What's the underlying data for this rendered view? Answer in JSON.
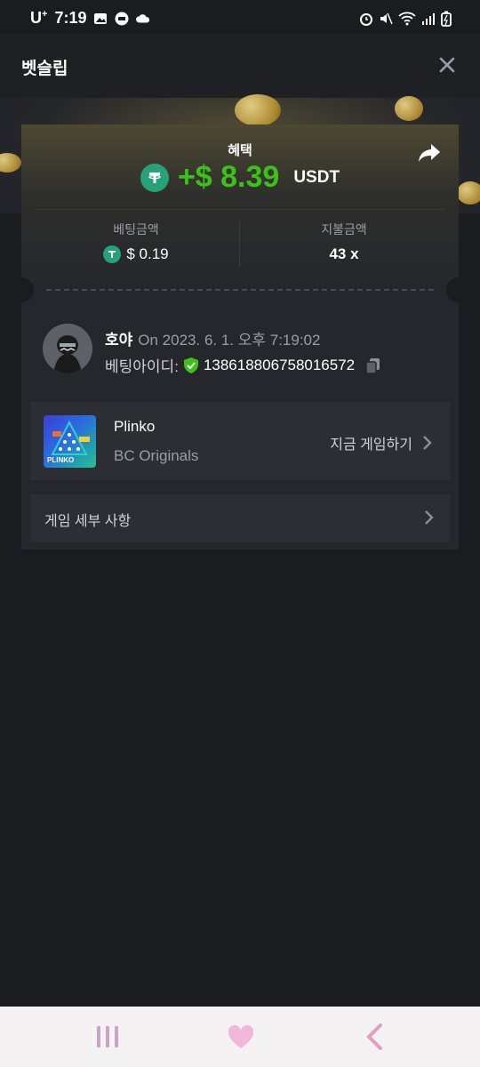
{
  "status_bar": {
    "carrier": "U",
    "carrier_sup": "+",
    "time": "7:19"
  },
  "header": {
    "title": "벳슬립"
  },
  "bet": {
    "benefit_label": "혜택",
    "profit": "+$ 8.39",
    "currency": "USDT",
    "bet_amount_label": "베팅금액",
    "bet_amount": "$ 0.19",
    "payout_label": "지불금액",
    "payout": "43 x"
  },
  "user": {
    "name": "호야",
    "timestamp": "On 2023. 6. 1. 오후 7:19:02",
    "bet_id_label": "베팅아이디:",
    "bet_id": "138618806758016572"
  },
  "game": {
    "name": "Plinko",
    "provider": "BC Originals",
    "play_label": "지금 게임하기",
    "thumb_text": "PLINKO"
  },
  "details": {
    "label": "게임 세부 사항"
  },
  "colors": {
    "profit_green": "#3bc117",
    "tether_green": "#27a17a",
    "background": "#1b1c1f",
    "card": "#25272c"
  },
  "icons": [
    "close-icon",
    "share-icon",
    "tether-icon",
    "shield-check-icon",
    "copy-icon",
    "chevron-right-icon",
    "recent-apps-icon",
    "home-icon",
    "back-icon"
  ]
}
